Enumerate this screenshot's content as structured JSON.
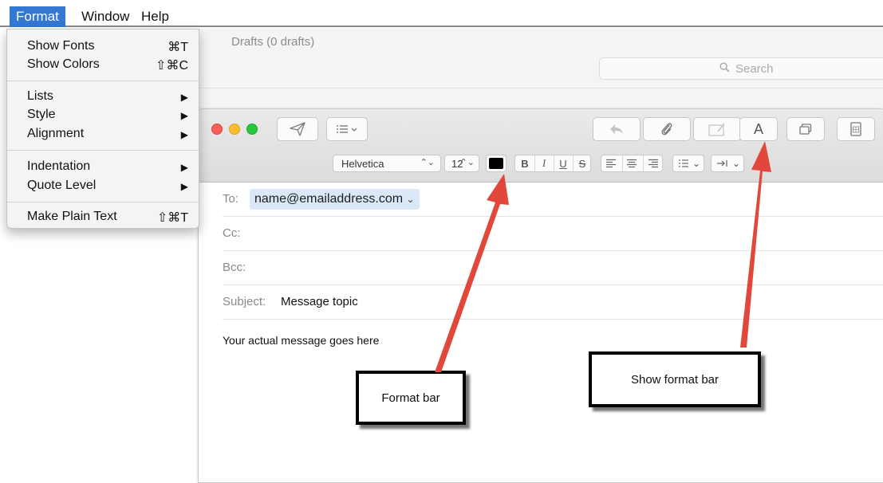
{
  "menubar": {
    "items": [
      {
        "label": "Format",
        "active": true
      },
      {
        "label": "Window",
        "active": false
      },
      {
        "label": "Help",
        "active": false
      }
    ]
  },
  "format_menu": {
    "groups": [
      [
        {
          "label": "Show Fonts",
          "shortcut": "⌘T"
        },
        {
          "label": "Show Colors",
          "shortcut": "⇧⌘C"
        }
      ],
      [
        {
          "label": "Lists",
          "submenu": true
        },
        {
          "label": "Style",
          "submenu": true
        },
        {
          "label": "Alignment",
          "submenu": true
        }
      ],
      [
        {
          "label": "Indentation",
          "submenu": true
        },
        {
          "label": "Quote Level",
          "submenu": true
        }
      ],
      [
        {
          "label": "Make Plain Text",
          "shortcut": "⇧⌘T"
        }
      ]
    ],
    "submenu_arrow": "▶"
  },
  "background_window": {
    "mailbox_title": "Drafts (0 drafts)",
    "search_placeholder": "Search"
  },
  "compose": {
    "toolbar": {
      "format_bar_toggle_label": "A",
      "icons": [
        "send-icon",
        "header-fields-icon",
        "reply-icon",
        "paperclip-icon",
        "markup-icon",
        "format-bar-toggle-icon",
        "photo-browser-icon",
        "stationery-icon"
      ]
    },
    "format_bar": {
      "font": "Helvetica",
      "size": "12",
      "select_chevron": "⌃⌄",
      "text_color": "#000000",
      "styles": {
        "bold": "B",
        "italic": "I",
        "underline": "U",
        "strike": "S"
      },
      "list_chevron": "⌄",
      "indent_chevron": "⌄"
    },
    "fields": {
      "to_label": "To:",
      "to_value": "name@emailaddress.com",
      "recipient_chevron": "⌄",
      "cc_label": "Cc:",
      "bcc_label": "Bcc:",
      "subject_label": "Subject:",
      "subject_value": "Message topic"
    },
    "body_text": "Your actual message goes here"
  },
  "callouts": {
    "format_bar": "Format bar",
    "show_format_bar": "Show format bar"
  },
  "colors": {
    "menu_highlight": "#3478d3",
    "arrow": "#e1483b",
    "recipient_token": "#dbe8f8"
  }
}
